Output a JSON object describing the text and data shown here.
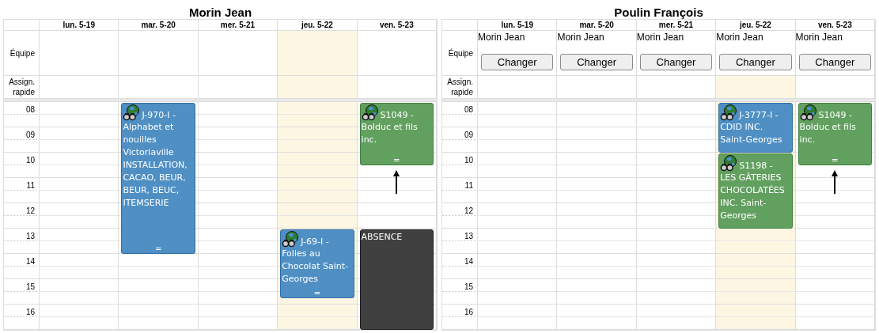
{
  "calendars": [
    {
      "title": "Morin Jean",
      "row_labels": {
        "team": "Équipe",
        "quick": "Assign. rapide"
      },
      "days": [
        {
          "label": "lun. 5-19",
          "today": false
        },
        {
          "label": "mar. 5-20",
          "today": false,
          "events": [
            {
              "kind": "job",
              "code": "J-970-I -",
              "text": "Alphabet et nouilles Victoriaville INSTALLATION, CACAO, BEUR, BEUR, BEUC, ITEMSERIE",
              "handle": "="
            }
          ]
        },
        {
          "label": "mer. 5-21",
          "today": false
        },
        {
          "label": "jeu. 5-22",
          "today": true,
          "events": [
            {
              "kind": "job",
              "code": "J-69-I -",
              "text": "Folies au Chocolat Saint-Georges",
              "handle": "="
            }
          ]
        },
        {
          "label": "ven. 5-23",
          "today": false,
          "events": [
            {
              "kind": "service",
              "code": "S1049 -",
              "text": "Bolduc et fils inc.",
              "handle": "=",
              "arrow_below": true
            },
            {
              "kind": "absence",
              "text": "ABSENCE"
            }
          ]
        }
      ],
      "hours": [
        "08",
        "09",
        "10",
        "11",
        "12",
        "13",
        "14",
        "15",
        "16"
      ]
    },
    {
      "title": "Poulin François",
      "row_labels": {
        "team": "Équipe",
        "quick": "Assign. rapide"
      },
      "days": [
        {
          "label": "lun. 5-19",
          "today": false,
          "team": "Morin Jean",
          "button": "Changer"
        },
        {
          "label": "mar. 5-20",
          "today": false,
          "team": "Morin Jean",
          "button": "Changer"
        },
        {
          "label": "mer. 5-21",
          "today": false,
          "team": "Morin Jean",
          "button": "Changer"
        },
        {
          "label": "jeu. 5-22",
          "today": true,
          "team": "Morin Jean",
          "button": "Changer",
          "events": [
            {
              "kind": "job",
              "code": "J-3777-I -",
              "text": "CDID INC. Saint-Georges"
            },
            {
              "kind": "service",
              "code": "S1198 -",
              "text": "LES GÂTERIES CHOCOLATÉES INC. Saint-Georges"
            }
          ]
        },
        {
          "label": "ven. 5-23",
          "today": false,
          "team": "Morin Jean",
          "button": "Changer",
          "events": [
            {
              "kind": "service",
              "code": "S1049 -",
              "text": "Bolduc et fils inc.",
              "handle": "=",
              "arrow_below": true
            }
          ]
        }
      ],
      "hours": [
        "08",
        "09",
        "10",
        "11",
        "12",
        "13",
        "14",
        "15",
        "16"
      ]
    }
  ]
}
